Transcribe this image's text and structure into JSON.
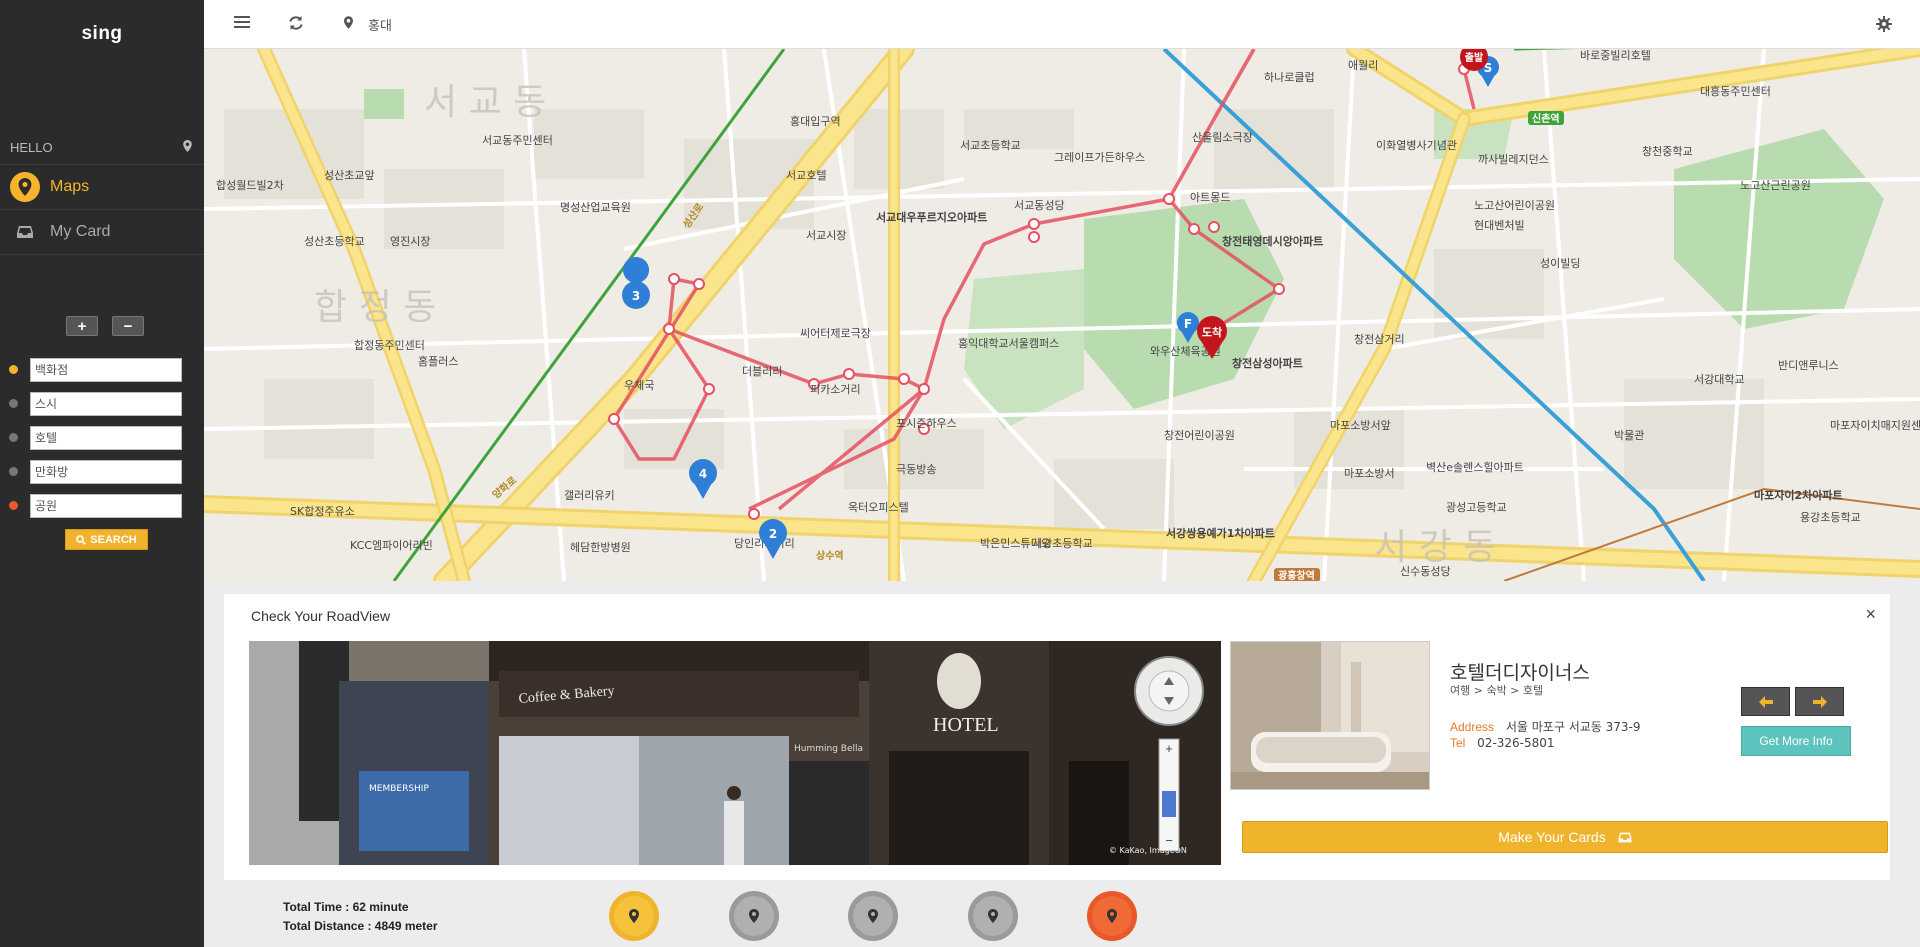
{
  "app": {
    "brand": "sing"
  },
  "sidebar": {
    "hello": "HELLO",
    "nav": [
      {
        "label": "Maps",
        "icon": "map-pin-icon",
        "active": true
      },
      {
        "label": "My Card",
        "icon": "inbox-icon",
        "active": false
      }
    ],
    "add_label": "+",
    "remove_label": "−",
    "categories": [
      {
        "value": "백화점",
        "color": "#f0b42c"
      },
      {
        "value": "스시",
        "color": "#777777"
      },
      {
        "value": "호텔",
        "color": "#777777"
      },
      {
        "value": "만화방",
        "color": "#777777"
      },
      {
        "value": "공원",
        "color": "#e8582a"
      }
    ],
    "search_label": "SEARCH"
  },
  "topbar": {
    "location": "홍대",
    "menu_icon": "hamburger-icon",
    "refresh_icon": "refresh-icon",
    "settings_icon": "gear-icon"
  },
  "map": {
    "district_labels": [
      "서 교 동",
      "합 정 동",
      "서 강 동"
    ],
    "places": [
      "서교동주민센터",
      "성산초교앞",
      "합성월드빌2차",
      "성산초등학교",
      "영진시장",
      "합정동주민센터",
      "홈플러스",
      "홍대입구역",
      "서교호텔",
      "명성산업교육원",
      "서교시장",
      "서교대우푸르지오아파트",
      "서교초등학교",
      "그레이프가든하우스",
      "서교동성당",
      "산울림소극장",
      "아트몽드",
      "창전태영데시앙아파트",
      "와우산체육공원",
      "창전삼성아파트",
      "창전어린이공원",
      "창전삼거리",
      "마포소방서앞",
      "마포소방서",
      "벽산e솔렌스힐아파트",
      "광성고등학교",
      "서강쌍용예가1차아파트",
      "극동방송",
      "포시즌하우스",
      "옥터오피스텔",
      "씨어터제로극장",
      "더블러리",
      "피카소거리",
      "우체국",
      "갤러리유키",
      "헤담한방병원",
      "KCC엠파이어리빈",
      "SK합정주유소",
      "당인리사거리",
      "박은민스튜디오",
      "서강초등학교",
      "홍익대학교서울캠퍼스",
      "노고산어린이공원",
      "현대벤처빌",
      "성이빌딩",
      "이화열병사기념관",
      "까사빌레지던스",
      "대흥동주민센터",
      "창천중학교",
      "노고산근린공원",
      "바로중빌리호텔",
      "하나로클럽",
      "반디앤루니스",
      "서강대학교",
      "박물관",
      "마포자이2차아파트",
      "마포자이치매지원센터",
      "용강초등학교",
      "신수동성당",
      "신촌역",
      "광흥창역",
      "성산로",
      "양화로",
      "상수역",
      "애월리"
    ],
    "markers": [
      {
        "label": "3",
        "color": "#2f7fd8"
      },
      {
        "label": "4",
        "color": "#2f7fd8"
      },
      {
        "label": "2",
        "color": "#2f7fd8"
      },
      {
        "label": "F",
        "color": "#2f7fd8"
      },
      {
        "label": "S",
        "color": "#2f7fd8"
      },
      {
        "label": "도착",
        "color": "#c2161c"
      },
      {
        "label": "출발",
        "color": "#c2161c"
      }
    ]
  },
  "panel": {
    "title": "Check Your RoadView",
    "close": "×",
    "roadview": {
      "hotel_sign": "HOTEL",
      "cafe_sign": "Coffee & Bakery",
      "shop_sign": "Humming Bella",
      "membership_sign": "MEMBERSHIP",
      "credit": "© KaKao, ImageON",
      "zoom_in": "+",
      "zoom_out": "−"
    },
    "place": {
      "name": "호텔더디자이너스",
      "category": "여행 > 숙박 > 호텔",
      "address_label": "Address",
      "address": "서울 마포구 서교동 373-9",
      "tel_label": "Tel",
      "tel": "02-326-5801"
    },
    "prev_icon": "arrow-left-icon",
    "next_icon": "arrow-right-icon",
    "more_label": "Get More Info",
    "cards_label": "Make Your Cards"
  },
  "footer": {
    "total_time": "Total Time : 62 minute",
    "total_distance": "Total Distance : 4849 meter",
    "circles": [
      {
        "color": "#f0b42c",
        "inner": "#f5c23a"
      },
      {
        "color": "#9a9a9a",
        "inner": "#b0b0b0"
      },
      {
        "color": "#9a9a9a",
        "inner": "#b0b0b0"
      },
      {
        "color": "#9a9a9a",
        "inner": "#b0b0b0"
      },
      {
        "color": "#e8582a",
        "inner": "#ef6a34"
      }
    ]
  }
}
